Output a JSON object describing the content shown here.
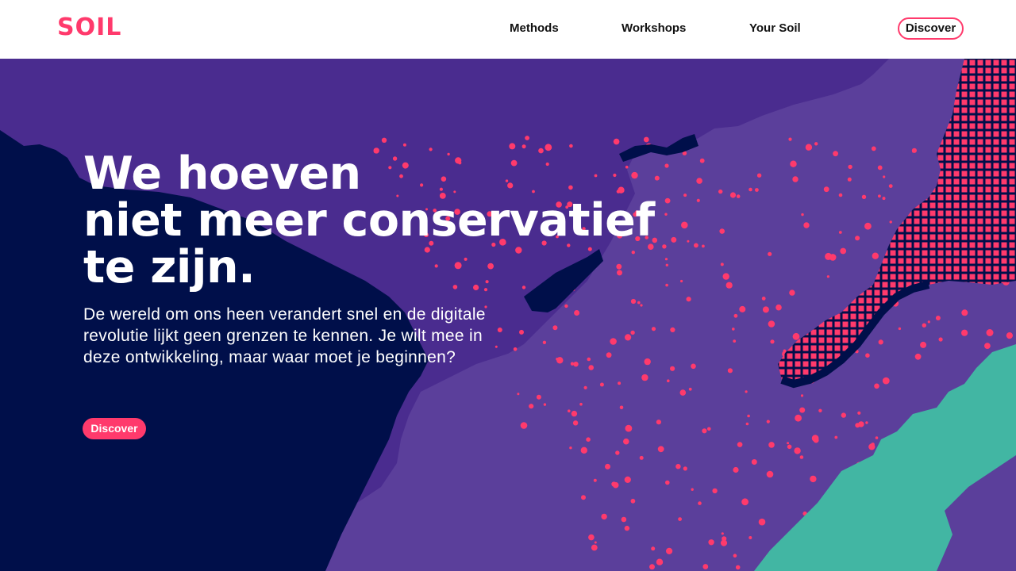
{
  "brand": {
    "logo_text": "SOIL",
    "accent": "#ff3a6c"
  },
  "nav": {
    "items": [
      {
        "label": "Methods"
      },
      {
        "label": "Workshops"
      },
      {
        "label": "Your Soil"
      }
    ],
    "cta_label": "Discover"
  },
  "hero": {
    "headline_lines": [
      "We hoeven",
      "niet meer conservatief",
      "te zijn."
    ],
    "subtext_lines": [
      "De wereld om ons heen verandert snel en de digitale",
      "revolutie lijkt geen grenzen te kennen. Je wilt mee in",
      "deze ontwikkeling, maar waar moet je beginnen?"
    ],
    "cta_label": "Discover"
  },
  "colors": {
    "navy": "#000f4a",
    "purple_dark": "#4a2c8f",
    "purple_light": "#5b3f9b",
    "pink": "#ff3a6c",
    "teal": "#42b6a3"
  }
}
